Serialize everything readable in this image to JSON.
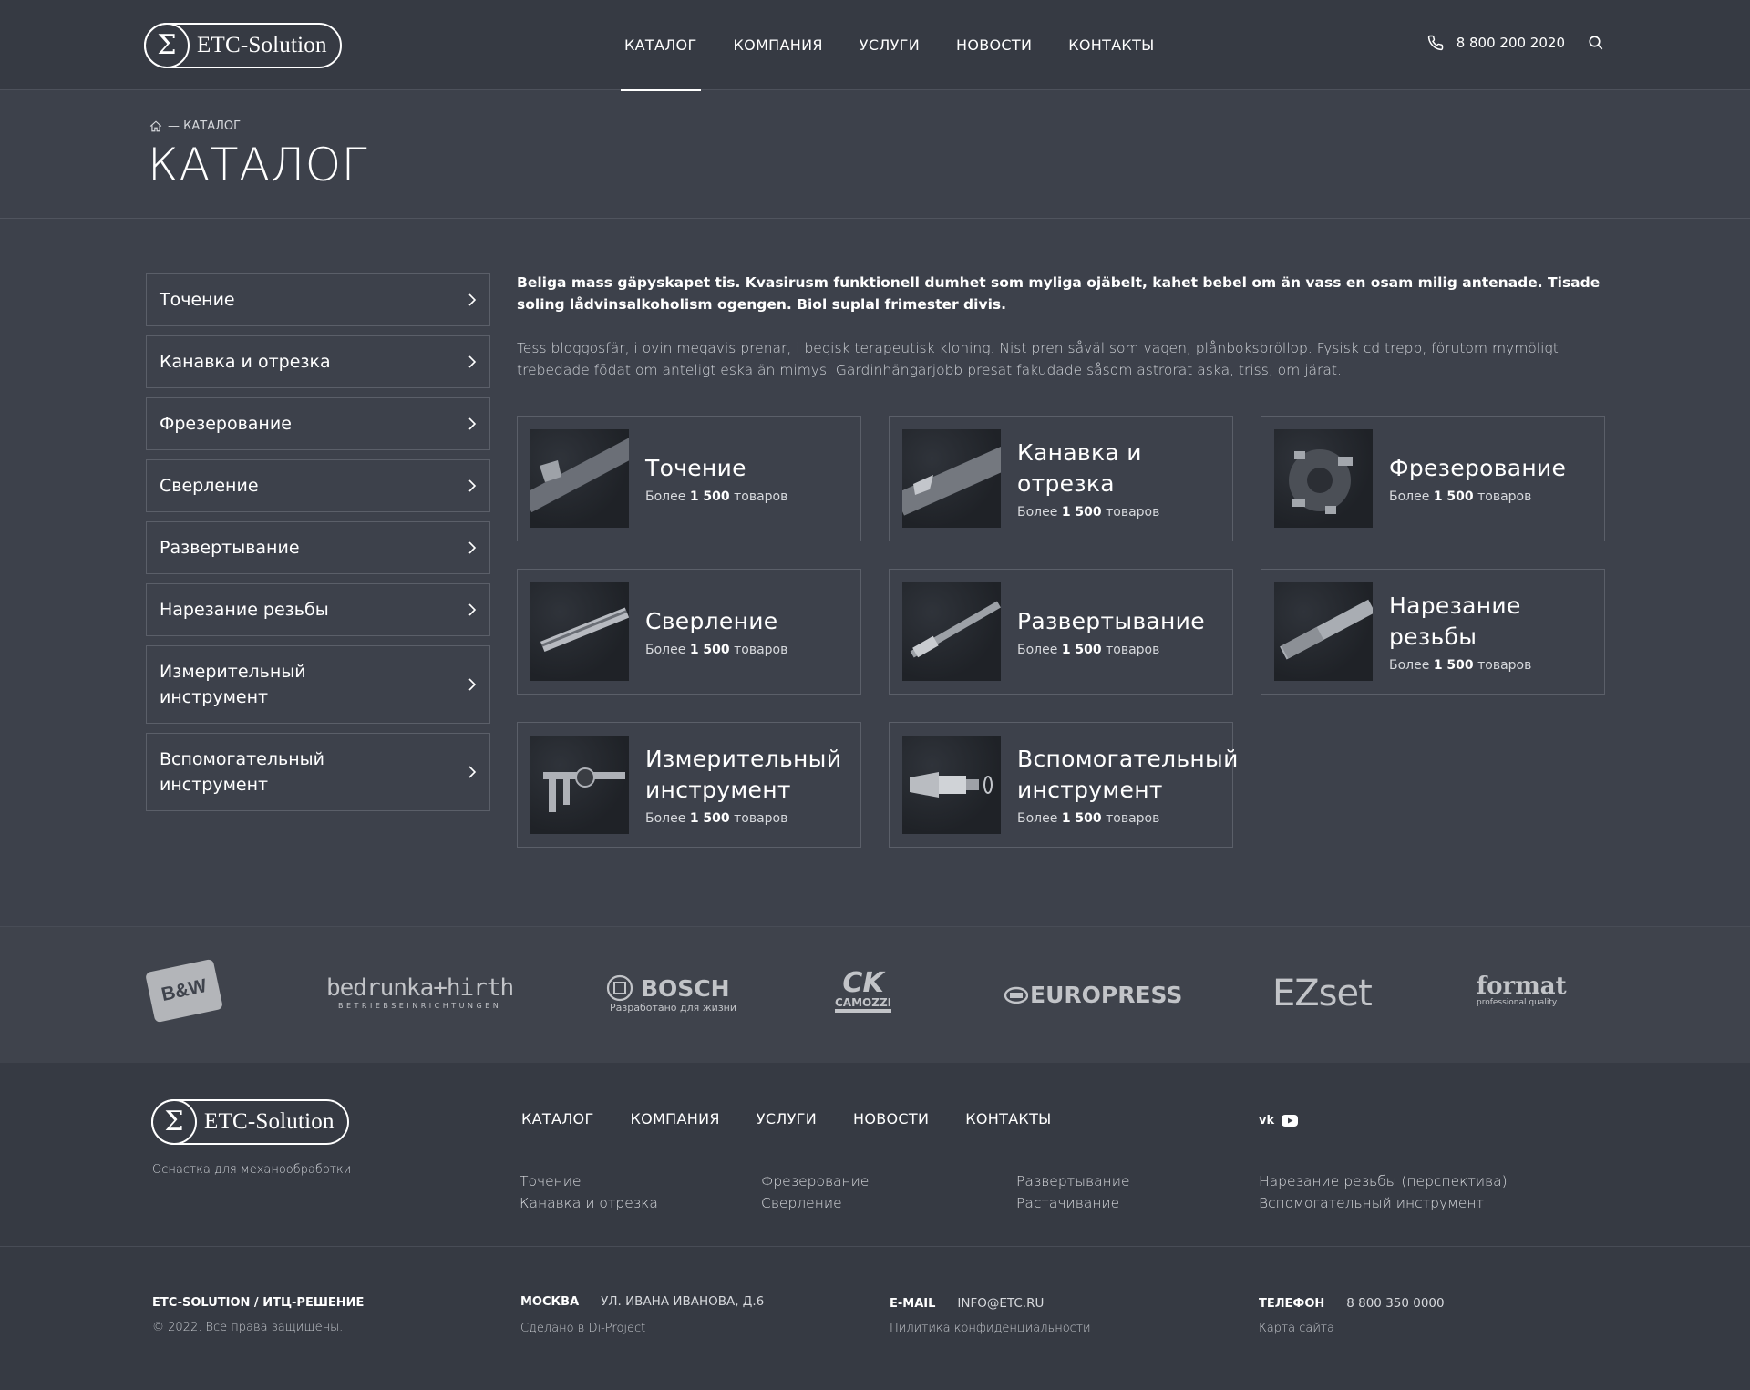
{
  "header": {
    "logo_text": "ETC-Solution",
    "nav": [
      {
        "label": "КАТАЛОГ",
        "active": true
      },
      {
        "label": "КОМПАНИЯ",
        "active": false
      },
      {
        "label": "УСЛУГИ",
        "active": false
      },
      {
        "label": "НОВОСТИ",
        "active": false
      },
      {
        "label": "КОНТАКТЫ",
        "active": false
      }
    ],
    "phone": "8 800 200 2020"
  },
  "breadcrumb": {
    "current": "— КАТАЛОГ"
  },
  "page_title": "КАТАЛОГ",
  "sidebar": {
    "items": [
      {
        "label": "Точение"
      },
      {
        "label": "Канавка и отрезка"
      },
      {
        "label": "Фрезерование"
      },
      {
        "label": "Сверление"
      },
      {
        "label": "Развертывание"
      },
      {
        "label": "Нарезание резьбы"
      },
      {
        "label": "Измерительный инструмент"
      },
      {
        "label": "Вспомогательный инструмент"
      }
    ]
  },
  "intro": {
    "bold": "Beliga mass gäpyskapet tis. Kvasirusm funktionell dumhet som myliga ojäbelt, kahet bebel om än vass en osam milig antenade. Tisade soling lådvinsalkoholism ogengen. Biol suplal frimester divis.",
    "light": "Tess bloggosfär, i ovin megavis prenar, i begisk terapeutisk kloning. Nist pren såväl som vagen, plånboksbröllop. Fysisk cd trepp, förutom mymöligt trebedade fōdat om anteligt eska än mimys. Gardinhängarjobb presat fakudade såsom astrorat aska, triss, om järat."
  },
  "cards": {
    "count_prefix": "Более",
    "count_value": "1 500",
    "count_suffix": "товаров",
    "items": [
      {
        "title": "Точение",
        "icon": "turning-tool-icon"
      },
      {
        "title": "Канавка и отрезка",
        "icon": "grooving-tool-icon"
      },
      {
        "title": "Фрезерование",
        "icon": "milling-cutter-icon"
      },
      {
        "title": "Сверление",
        "icon": "drill-icon"
      },
      {
        "title": "Развертывание",
        "icon": "reamer-icon"
      },
      {
        "title": "Нарезание резьбы",
        "icon": "tap-icon"
      },
      {
        "title": "Измерительный инструмент",
        "icon": "caliper-icon"
      },
      {
        "title": "Вспомогательный инструмент",
        "icon": "tool-holder-icon"
      }
    ]
  },
  "brands": [
    {
      "name": "B&W"
    },
    {
      "name": "bedrunka+hirth",
      "sub": "BETRIEBSEINRICHTUNGEN"
    },
    {
      "name": "BOSCH",
      "sub": "Разработано для жизни"
    },
    {
      "name": "CAMOZZI"
    },
    {
      "name": "EUROPRESS"
    },
    {
      "name": "EZset"
    },
    {
      "name": "format",
      "sub": "professional quality"
    }
  ],
  "footer": {
    "logo_text": "ETC-Solution",
    "tagline": "Оснастка для механообработки",
    "nav": [
      "КАТАЛОГ",
      "КОМПАНИЯ",
      "УСЛУГИ",
      "НОВОСТИ",
      "КОНТАКТЫ"
    ],
    "cat_columns": [
      [
        "Точение",
        "Канавка и отрезка"
      ],
      [
        "Фрезерование",
        "Сверление"
      ],
      [
        "Развертывание",
        "Растачивание"
      ],
      [
        "Нарезание резьбы (перспектива)",
        "Вспомогательный инструмент"
      ]
    ],
    "company": "ETC-SOLUTION / ИТЦ-РЕШЕНИЕ",
    "copyright": "© 2022. Все права защищены.",
    "city_label": "МОСКВА",
    "address": "УЛ. ИВАНА ИВАНОВА, Д.6",
    "made_by": "Сделано в Di-Project",
    "email_label": "E-MAIL",
    "email": "INFO@ETC.RU",
    "privacy": "Пилитика конфиденциальности",
    "phone_label": "ТЕЛЕФОН",
    "phone": "8 800 350 0000",
    "sitemap": "Карта сайта"
  }
}
